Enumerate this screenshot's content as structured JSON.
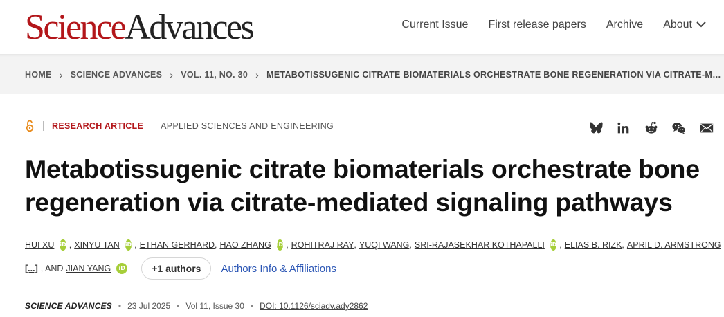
{
  "header": {
    "logo_part1": "Science",
    "logo_part2": "Advances",
    "nav": [
      "Current Issue",
      "First release papers",
      "Archive",
      "About"
    ]
  },
  "breadcrumb": {
    "items": [
      "HOME",
      "SCIENCE ADVANCES",
      "VOL. 11, NO. 30"
    ],
    "current": "METABOTISSUGENIC CITRATE BIOMATERIALS ORCHESTRATE BONE REGENERATION VIA CITRATE-MEDIATED SIGNALING PATHWAYS"
  },
  "article": {
    "type": "RESEARCH ARTICLE",
    "subject": "APPLIED SCIENCES AND ENGINEERING",
    "title": "Metabotissugenic citrate biomaterials orchestrate bone regeneration via citrate-mediated signaling pathways",
    "authors_line1": [
      {
        "name": "Hui Xu",
        "orcid": true
      },
      {
        "name": "Xinyu Tan",
        "orcid": true
      },
      {
        "name": "Ethan Gerhard",
        "orcid": false
      },
      {
        "name": "Hao Zhang",
        "orcid": true
      },
      {
        "name": "Rohitraj Ray",
        "orcid": false
      },
      {
        "name": "Yuqi Wang",
        "orcid": false
      },
      {
        "name": "Sri-Rajasekhar Kothapalli",
        "orcid": true
      },
      {
        "name": "Elias B. Rizk",
        "orcid": false
      },
      {
        "name": "April D. Armstrong",
        "orcid": true
      }
    ],
    "authors_ellipsis": "[...]",
    "authors_and": ", AND",
    "last_author": "JIAN YANG",
    "more_authors": "+1 authors",
    "affiliations_link": "Authors Info & Affiliations",
    "orcid_label": "iD"
  },
  "publication": {
    "journal": "SCIENCE ADVANCES",
    "date": "23 Jul 2025",
    "volume": "Vol 11, Issue 30",
    "doi": "DOI: 10.1126/sciadv.ady2862"
  },
  "icons": {
    "share": [
      "bluesky-icon",
      "linkedin-icon",
      "reddit-icon",
      "wechat-icon",
      "email-icon"
    ]
  },
  "colors": {
    "brand_red": "#b3161a",
    "orcid_green": "#a6ce39",
    "link_blue": "#2b56b5",
    "open_access_orange": "#e88a1a"
  }
}
